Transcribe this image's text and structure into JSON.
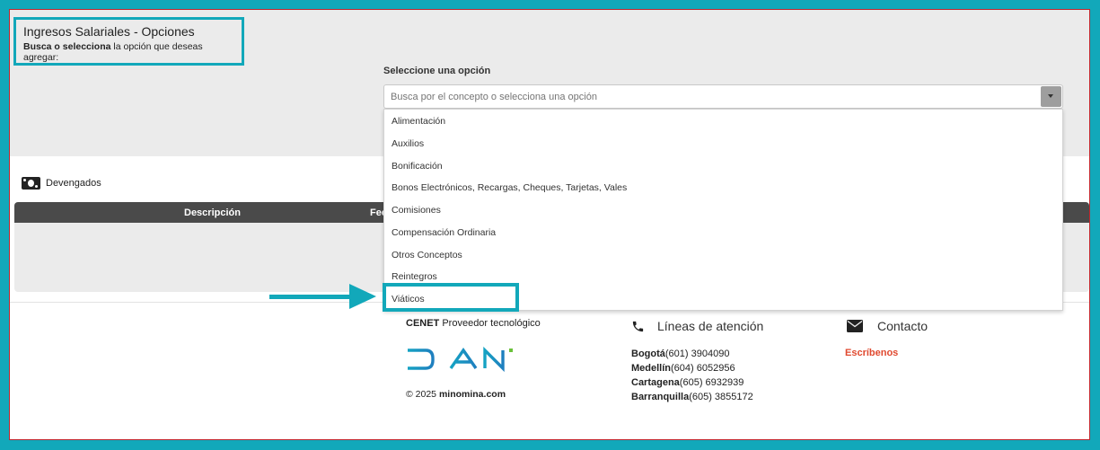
{
  "header": {
    "title": "Ingresos Salariales - Opciones",
    "subtitle_bold": "Busca o selecciona",
    "subtitle_rest": " la opción que deseas agregar:"
  },
  "select": {
    "label": "Seleccione una opción",
    "placeholder": "Busca por el concepto o selecciona una opción",
    "options": [
      "Alimentación",
      "Auxilios",
      "Bonificación",
      "Bonos Electrónicos, Recargas, Cheques, Tarjetas, Vales",
      "Comisiones",
      "Compensación Ordinaria",
      "Otros Conceptos",
      "Reintegros",
      "Viáticos"
    ],
    "highlighted_option": "Viáticos"
  },
  "section": {
    "label": "Devengados",
    "columns": [
      "Descripción",
      "Fec"
    ]
  },
  "footer": {
    "provider_bold": "CENET",
    "provider_rest": " Proveedor tecnológico",
    "logo_text": "DIAN",
    "copyright_pre": "© 2025 ",
    "copyright_bold": "minomina.com",
    "lines_title": "Líneas de atención",
    "phones": [
      {
        "city": "Bogotá",
        "number": "(601) 3904090"
      },
      {
        "city": "Medellín",
        "number": "(604) 6052956"
      },
      {
        "city": "Cartagena",
        "number": "(605) 6932939"
      },
      {
        "city": "Barranquilla",
        "number": "(605) 3855172"
      }
    ],
    "contact_title": "Contacto",
    "contact_link": "Escríbenos"
  },
  "colors": {
    "accent": "#12a8ba",
    "frame_border": "#c0262d",
    "link": "#e0492f",
    "table_header": "#4a4a4a"
  },
  "icons": [
    "money-icon",
    "phone-icon",
    "envelope-icon",
    "chevron-down-icon",
    "arrow-right-icon"
  ]
}
